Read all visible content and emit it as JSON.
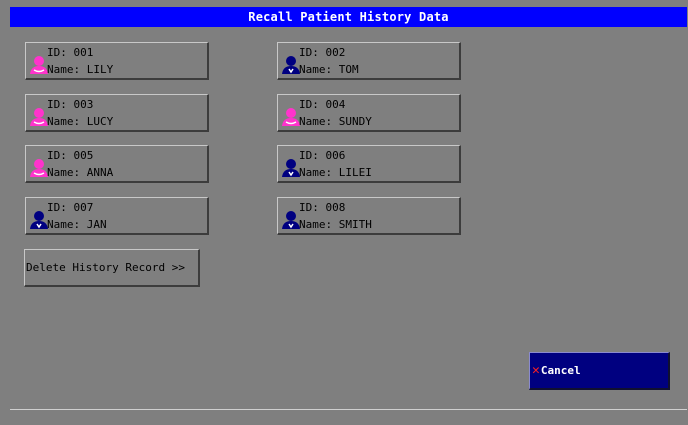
{
  "title": "Recall Patient History Data",
  "colors": {
    "title_bar": "#0000ff",
    "background": "#7f7f7f",
    "female_icon": "#ff33cc",
    "male_icon": "#000080",
    "cancel_bg": "#000080",
    "cancel_x": "#ff2020"
  },
  "patients": [
    {
      "id_text": "ID: 001",
      "name_text": "Name: LILY",
      "gender": "female",
      "icon": "female-patient-icon"
    },
    {
      "id_text": "ID: 002",
      "name_text": "Name: TOM",
      "gender": "male",
      "icon": "male-patient-icon"
    },
    {
      "id_text": "ID: 003",
      "name_text": "Name: LUCY",
      "gender": "female",
      "icon": "female-patient-icon"
    },
    {
      "id_text": "ID: 004",
      "name_text": "Name: SUNDY",
      "gender": "female",
      "icon": "female-patient-icon"
    },
    {
      "id_text": "ID: 005",
      "name_text": "Name: ANNA",
      "gender": "female",
      "icon": "female-patient-icon"
    },
    {
      "id_text": "ID: 006",
      "name_text": "Name: LILEI",
      "gender": "male",
      "icon": "male-patient-icon"
    },
    {
      "id_text": "ID: 007",
      "name_text": "Name: JAN",
      "gender": "male",
      "icon": "male-patient-icon"
    },
    {
      "id_text": "ID: 008",
      "name_text": "Name: SMITH",
      "gender": "male",
      "icon": "male-patient-icon"
    }
  ],
  "delete_label": "Delete History Record >>",
  "cancel": {
    "label": "Cancel",
    "icon": "close-icon"
  }
}
